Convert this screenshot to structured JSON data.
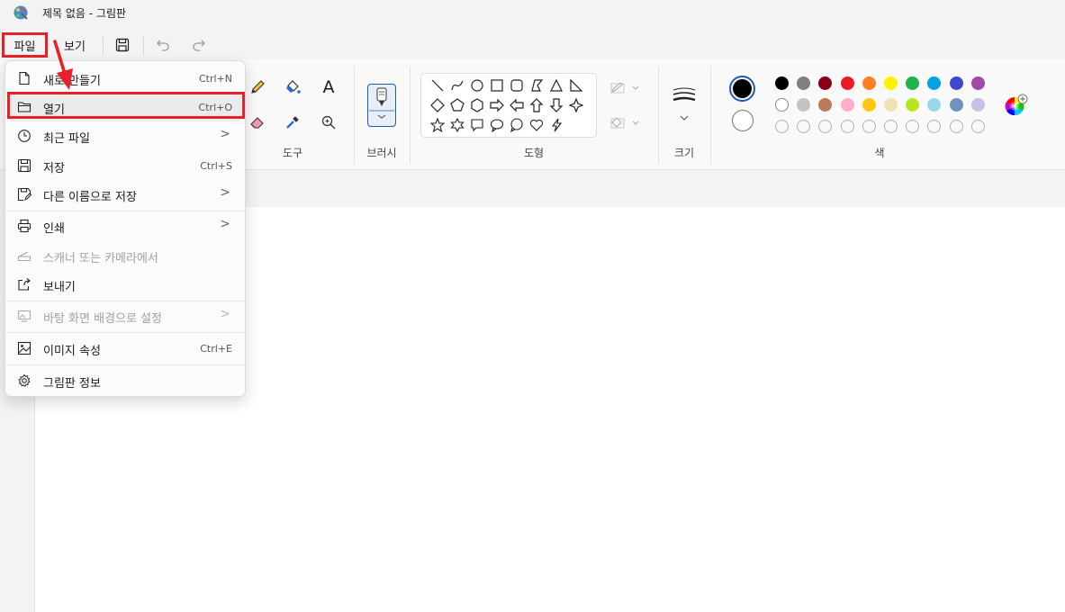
{
  "window": {
    "title": "제목 없음 - 그림판"
  },
  "menubar": {
    "file_label": "파일",
    "view_label": "보기"
  },
  "toolbar": {
    "save_icon": "save-icon",
    "undo_icon": "undo-icon",
    "redo_icon": "redo-icon"
  },
  "ribbon": {
    "groups": {
      "tools": "도구",
      "brushes": "브러시",
      "shapes": "도형",
      "size": "크기",
      "colors": "색"
    },
    "text_tool_glyph": "A"
  },
  "colors": {
    "primary": "#000000",
    "secondary": "#ffffff",
    "row1": [
      "#000000",
      "#7f7f7f",
      "#880015",
      "#ed1c24",
      "#ff7f27",
      "#fff200",
      "#22b14c",
      "#00a2e8",
      "#3f48cc",
      "#a349a4"
    ],
    "row2": [
      "#ffffff",
      "#c3c3c3",
      "#b97a57",
      "#ffaec9",
      "#ffc90e",
      "#efe4b0",
      "#b5e61d",
      "#99d9ea",
      "#7092be",
      "#c8bfe7"
    ],
    "annotation_red": "#e8202a"
  },
  "file_menu": {
    "items": [
      {
        "label": "새로 만들기",
        "shortcut": "Ctrl+N",
        "icon": "new-file-icon"
      },
      {
        "label": "열기",
        "shortcut": "Ctrl+O",
        "icon": "folder-icon"
      },
      {
        "label": "최근 파일",
        "chevron": ">",
        "icon": "clock-icon"
      },
      {
        "label": "저장",
        "shortcut": "Ctrl+S",
        "icon": "save-icon"
      },
      {
        "label": "다른 이름으로 저장",
        "chevron": ">",
        "icon": "save-as-icon"
      },
      {
        "label": "인쇄",
        "chevron": ">",
        "icon": "printer-icon"
      },
      {
        "label": "스캐너 또는 카메라에서",
        "icon": "scanner-icon"
      },
      {
        "label": "보내기",
        "icon": "share-icon"
      },
      {
        "label": "바탕 화면 배경으로 설정",
        "chevron": ">",
        "icon": "wallpaper-icon"
      },
      {
        "label": "이미지 속성",
        "shortcut": "Ctrl+E",
        "icon": "image-properties-icon"
      },
      {
        "label": "그림판 정보",
        "icon": "gear-icon"
      }
    ]
  }
}
